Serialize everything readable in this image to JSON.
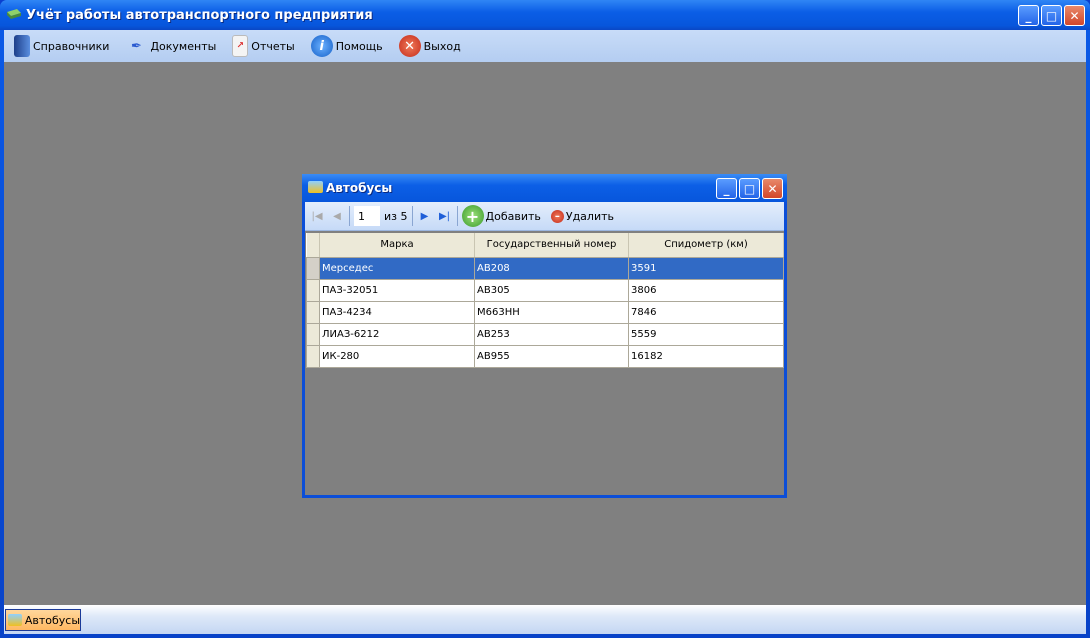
{
  "app": {
    "title": "Учёт работы автотранспортного предприятия"
  },
  "menu": [
    {
      "label": "Справочники",
      "icon": "book-icon"
    },
    {
      "label": "Документы",
      "icon": "pen-icon"
    },
    {
      "label": "Отчеты",
      "icon": "report-icon"
    },
    {
      "label": "Помощь",
      "icon": "info-icon"
    },
    {
      "label": "Выход",
      "icon": "exit-icon"
    }
  ],
  "child": {
    "title": "Автобусы",
    "toolbar": {
      "page": "1",
      "of": "из 5",
      "add": "Добавить",
      "delete": "Удалить"
    },
    "columns": [
      "Марка",
      "Государственный номер",
      "Спидометр (км)"
    ],
    "rows": [
      [
        "Мерседес",
        "АВ208",
        "3591"
      ],
      [
        "ПАЗ-32051",
        "АВ305",
        "3806"
      ],
      [
        "ПАЗ-4234",
        "М663НН",
        "7846"
      ],
      [
        "ЛИАЗ-6212",
        "АВ253",
        "5559"
      ],
      [
        "ИК-280",
        "АВ955",
        "16182"
      ]
    ],
    "selected_row": 0
  },
  "taskbar": {
    "tab": "Автобусы"
  }
}
